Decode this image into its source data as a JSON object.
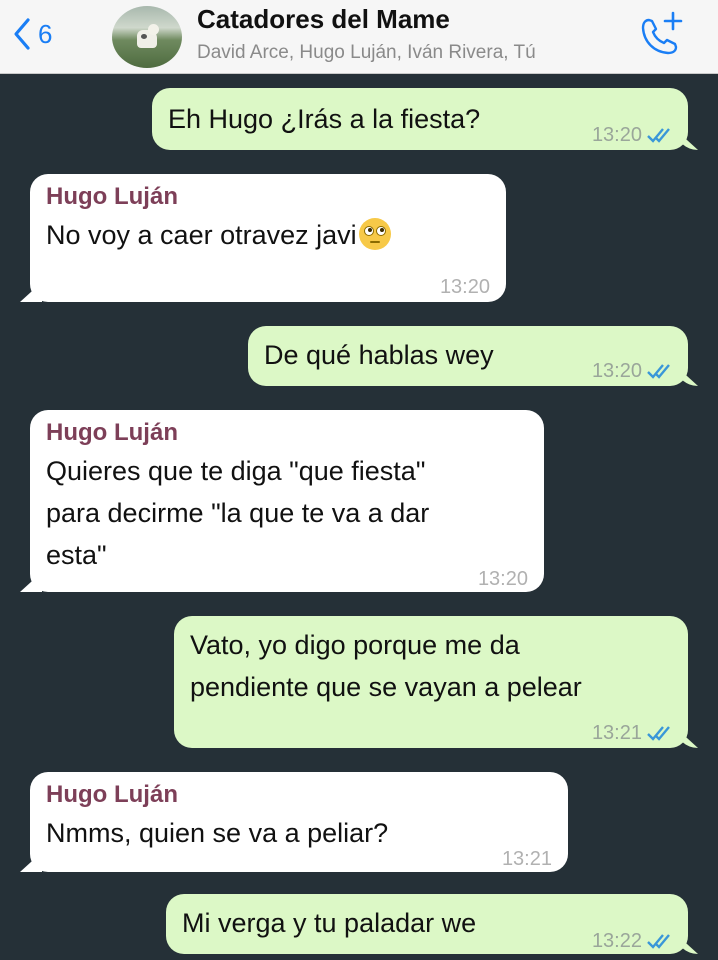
{
  "header": {
    "back_count": "6",
    "title": "Catadores del Mame",
    "members": "David Arce, Hugo Luján, Iván Rivera, Tú"
  },
  "messages": [
    {
      "direction": "out",
      "text": "Eh Hugo ¿Irás a la fiesta?",
      "time": "13:20",
      "status_icon": "double-check-icon"
    },
    {
      "direction": "in",
      "sender": "Hugo Luján",
      "text": "No voy a caer otravez javi",
      "emoji": "face-with-rolling-eyes",
      "time": "13:20"
    },
    {
      "direction": "out",
      "text": "De qué hablas wey",
      "time": "13:20",
      "status_icon": "double-check-icon"
    },
    {
      "direction": "in",
      "sender": "Hugo Luján",
      "lines": [
        "Quieres que te diga \"que fiesta\"",
        "para decirme \"la que te va a dar",
        "esta\""
      ],
      "time": "13:20"
    },
    {
      "direction": "out",
      "lines": [
        "Vato, yo digo porque me da",
        "pendiente que se vayan a pelear"
      ],
      "time": "13:21",
      "status_icon": "double-check-icon"
    },
    {
      "direction": "in",
      "sender": "Hugo Luján",
      "text": "Nmms, quien se va a peliar?",
      "time": "13:21"
    },
    {
      "direction": "out",
      "text": "Mi verga y tu paladar we",
      "time": "13:22",
      "status_icon": "double-check-icon"
    }
  ],
  "colors": {
    "chat_background": "#253037",
    "outgoing_bubble": "#dcf8c6",
    "incoming_bubble": "#ffffff",
    "sender_name": "#7d3f58",
    "accent": "#1a7ef5",
    "read_ticks": "#3a97d8"
  }
}
